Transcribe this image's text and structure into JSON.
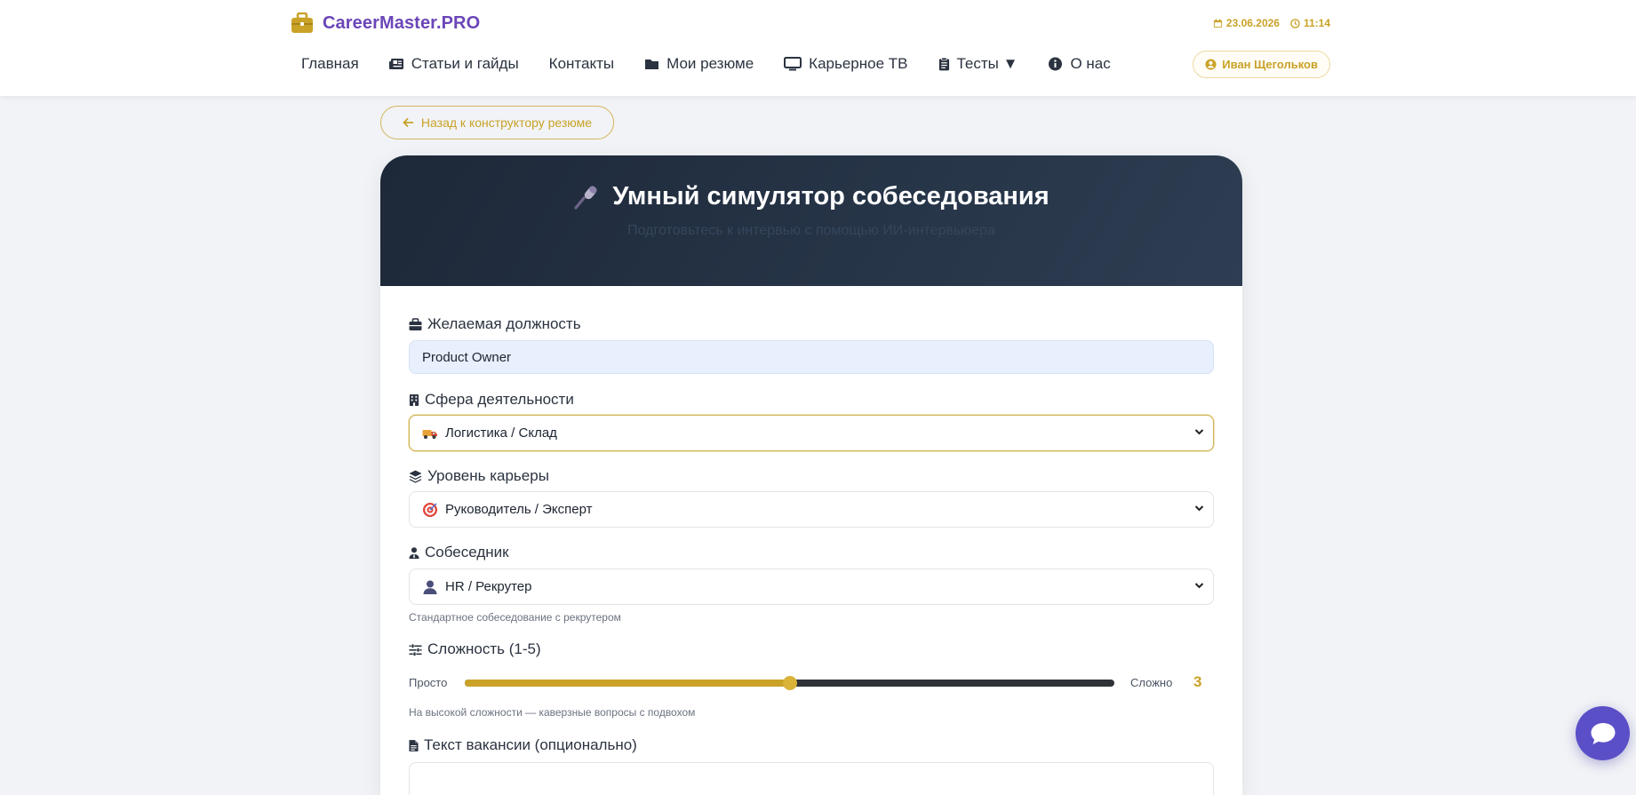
{
  "brand": {
    "name": "CareerMaster.PRO",
    "icon": "briefcase-icon",
    "color": "#6b46b8",
    "accent": "#c9a227"
  },
  "header": {
    "date": "23.06.2026",
    "time": "11:14",
    "nav": [
      {
        "label": "Главная",
        "icon": ""
      },
      {
        "label": "Статьи и гайды",
        "icon": "newspaper-icon"
      },
      {
        "label": "Контакты",
        "icon": ""
      },
      {
        "label": "Мои резюме",
        "icon": "folder-icon"
      },
      {
        "label": "Карьерное ТВ",
        "icon": "tv-icon"
      },
      {
        "label": "Тесты ▼",
        "icon": "clipboard-icon"
      },
      {
        "label": "О нас",
        "icon": "info-icon"
      }
    ],
    "user": "Иван Щегольков"
  },
  "back_button": "Назад к конструктору резюме",
  "hero": {
    "title": "Умный симулятор собеседования",
    "subtitle": "Подготовьтесь к интервью с помощью ИИ-интервьюера",
    "icon": "microphone-icon",
    "bg_color": "#1d2838"
  },
  "form": {
    "position": {
      "label": "Желаемая должность",
      "value": "Product Owner"
    },
    "industry": {
      "label": "Сфера деятельности",
      "value": "Логистика / Склад",
      "emoji": "truck"
    },
    "level": {
      "label": "Уровень карьеры",
      "value": "Руководитель / Эксперт",
      "emoji": "target"
    },
    "interviewer": {
      "label": "Собеседник",
      "value": "HR / Рекрутер",
      "emoji": "person",
      "hint": "Стандартное собеседование с рекрутером"
    },
    "difficulty": {
      "label": "Сложность (1-5)",
      "min_label": "Просто",
      "max_label": "Сложно",
      "value": "3",
      "fraction": 0.5,
      "hint": "На высокой сложности — каверзные вопросы с подвохом"
    },
    "vacancy": {
      "label": "Текст вакансии (опционально)"
    }
  },
  "chat": {
    "icon": "chat-bubble-icon",
    "color": "#5b4fc8"
  }
}
